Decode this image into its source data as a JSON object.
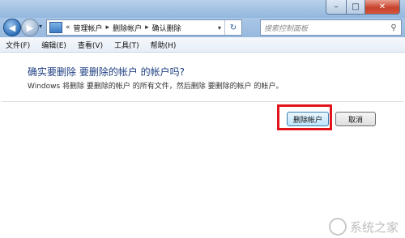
{
  "window": {
    "title": ""
  },
  "caption": {
    "minimize": "–",
    "maximize": "□",
    "close": "✕"
  },
  "nav": {
    "back_glyph": "◀",
    "forward_glyph": "▶",
    "history_dropdown": "▾",
    "breadcrumb": {
      "prefix": "«",
      "items": [
        "管理帐户",
        "删除帐户",
        "确认删除"
      ],
      "separator": "▸"
    },
    "address_dropdown": "▾",
    "refresh_glyph": "↻"
  },
  "search": {
    "placeholder": "搜索控制面板",
    "icon": "search-icon"
  },
  "menu": {
    "items": [
      "文件(F)",
      "编辑(E)",
      "查看(V)",
      "工具(T)",
      "帮助(H)"
    ]
  },
  "dialog": {
    "heading": "确实要删除 要删除的帐户 的帐户吗?",
    "description": "Windows 将删除 要删除的帐户 的所有文件，然后删除 要删除的帐户 的帐户。",
    "delete_button": "删除帐户",
    "cancel_button": "取消"
  },
  "colors": {
    "heading": "#1e3f82",
    "highlight_border": "#e2141b",
    "frame": "#a5c3e3"
  }
}
